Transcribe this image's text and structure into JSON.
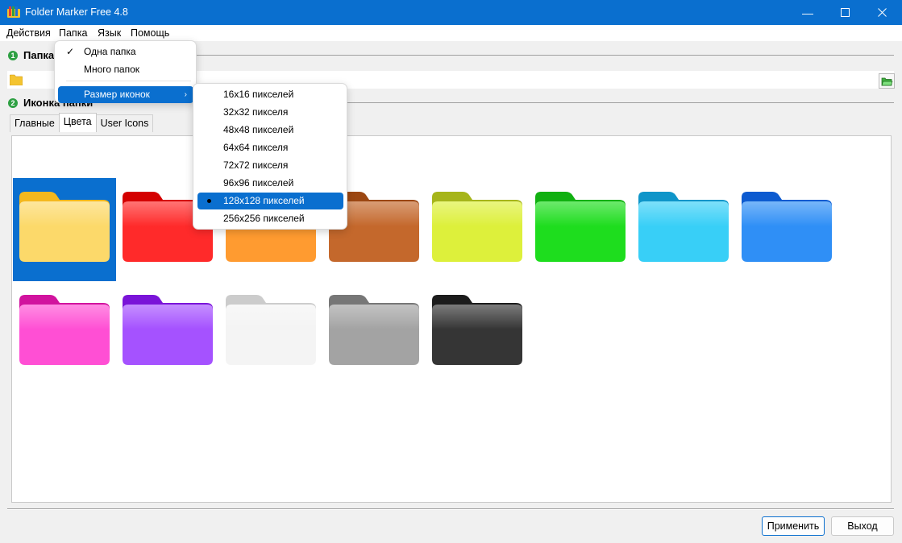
{
  "window": {
    "title": "Folder Marker Free 4.8",
    "controls": [
      "minimize-icon",
      "maximize-icon",
      "close-icon"
    ]
  },
  "menu": {
    "items": [
      "Действия",
      "Папка",
      "Язык",
      "Помощь"
    ]
  },
  "folder_menu": {
    "items": [
      {
        "label": "Одна папка",
        "checked": true
      },
      {
        "label": "Много папок",
        "checked": false
      },
      {
        "label": "Размер иконок",
        "submenu": true
      }
    ]
  },
  "size_submenu": {
    "items": [
      "16x16 пикселей",
      "32x32 пикселя",
      "48x48 пикселей",
      "64x64 пикселя",
      "72x72 пикселя",
      "96x96 пикселей",
      "128x128 пикселей",
      "256x256 пикселей"
    ],
    "selected": "128x128 пикселей"
  },
  "sections": {
    "folder_label": "Папка",
    "icon_label": "Иконка папки",
    "folder_num": "1",
    "icon_num": "2"
  },
  "tabs": [
    "Главные",
    "Цвета",
    "User Icons"
  ],
  "selected_tab": "Цвета",
  "palette": [
    {
      "color": "yellow",
      "top": "#f4b81e",
      "body": "#fcd96a",
      "selected": true
    },
    {
      "color": "red",
      "top": "#d40000",
      "body": "#ff2a2a"
    },
    {
      "color": "orange",
      "top": "#f07f10",
      "body": "#ff9b30"
    },
    {
      "color": "brown",
      "top": "#9c4712",
      "body": "#c4682c"
    },
    {
      "color": "lime",
      "top": "#a6b51a",
      "body": "#ddf03b"
    },
    {
      "color": "green",
      "top": "#11b011",
      "body": "#1edd1e"
    },
    {
      "color": "cyan",
      "top": "#0f95c9",
      "body": "#38cff7"
    },
    {
      "color": "blue",
      "top": "#0d5bd0",
      "body": "#2f8ff6"
    },
    {
      "color": "magenta",
      "top": "#d1139e",
      "body": "#ff4fd4"
    },
    {
      "color": "purple",
      "top": "#7a14d8",
      "body": "#a552ff"
    },
    {
      "color": "white",
      "top": "#cccccc",
      "body": "#f4f4f4"
    },
    {
      "color": "gray",
      "top": "#777777",
      "body": "#a3a3a3"
    },
    {
      "color": "black",
      "top": "#1c1c1c",
      "body": "#353535"
    }
  ],
  "buttons": {
    "apply": "Применить",
    "exit": "Выход"
  }
}
